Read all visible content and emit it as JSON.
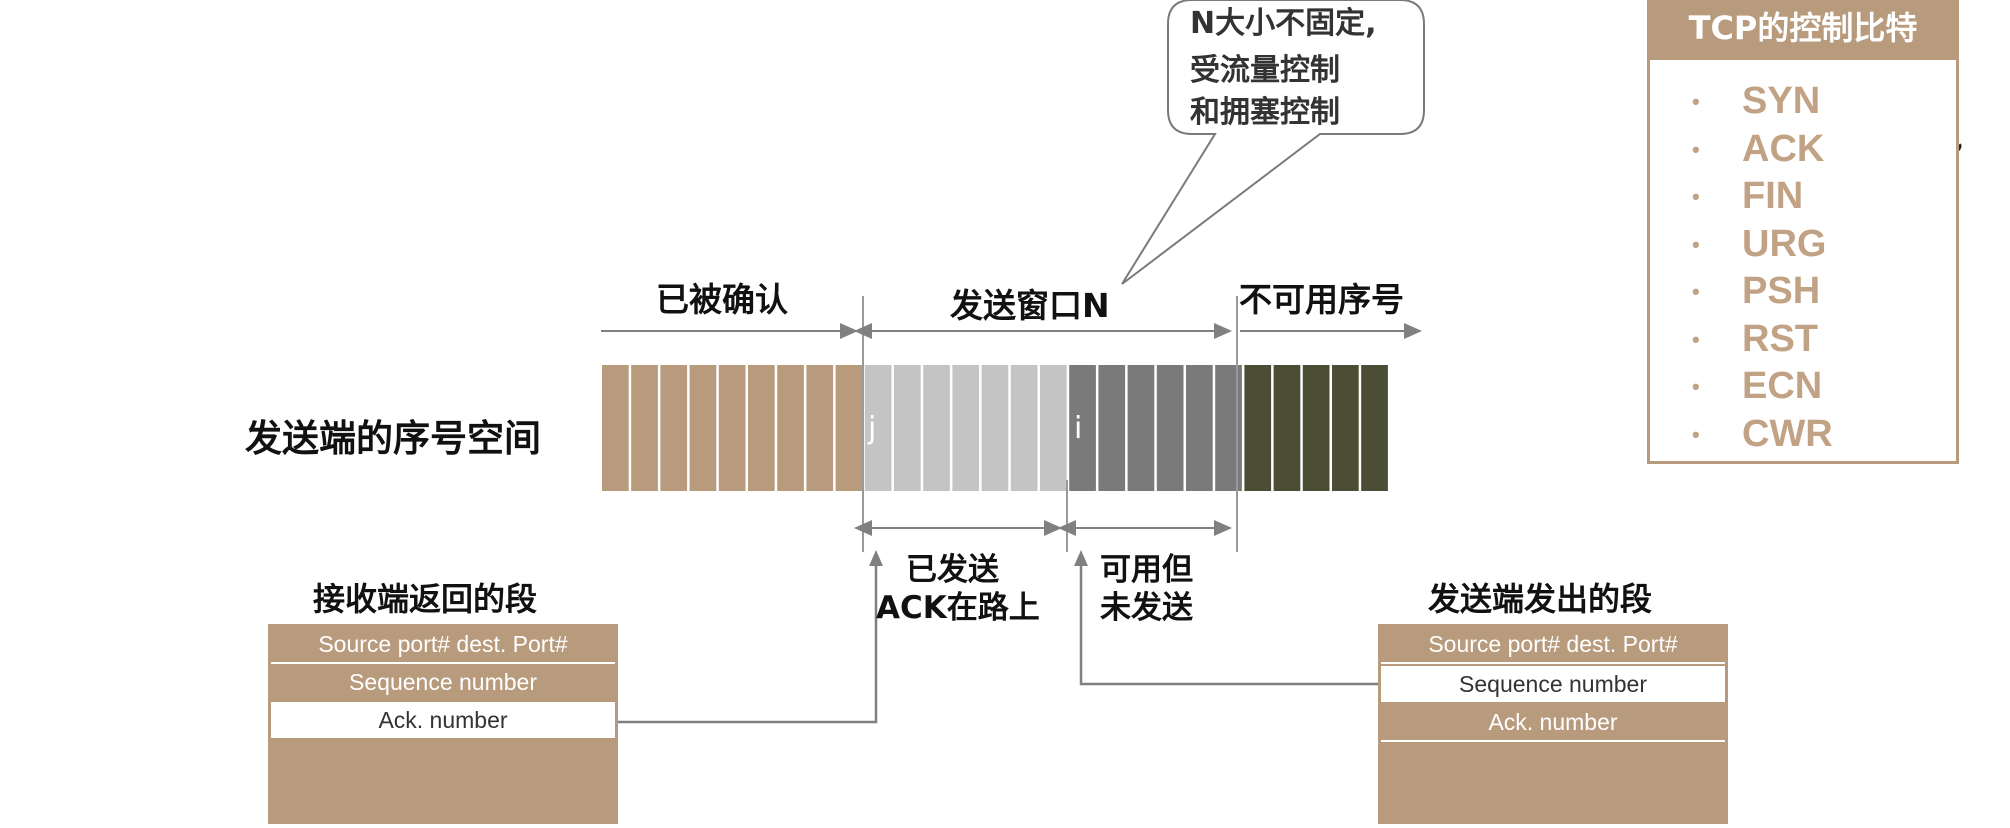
{
  "top_labels": {
    "confirmed": "已被确认",
    "window": "发送窗口N",
    "unusable": "不可用序号"
  },
  "row_label": "发送端的序号空间",
  "slot_markers": {
    "j": "j",
    "i": "i"
  },
  "bottom_labels": {
    "sent_ack_line1": "已发送",
    "sent_ack_line2": "ACK在路上",
    "usable_line1": "可用但",
    "usable_line2": "未发送"
  },
  "callout": {
    "line1": "N大小不固定,",
    "line2": "受流量控制",
    "line3": "和拥塞控制"
  },
  "receiver_segment": {
    "title": "接收端返回的段",
    "rows": [
      "Source port#  dest. Port#",
      "Sequence number",
      "Ack. number"
    ],
    "highlighted_row": "Ack. number"
  },
  "sender_segment": {
    "title": "发送端发出的段",
    "rows": [
      "Source port#  dest. Port#",
      "Sequence number",
      "Ack. number"
    ],
    "highlighted_row": "Sequence number"
  },
  "flags_panel": {
    "title": "TCP的控制比特",
    "items": [
      "SYN",
      "ACK",
      "FIN",
      "URG",
      "PSH",
      "RST",
      "ECN",
      "CWR"
    ],
    "circled": "ACK"
  },
  "colors": {
    "acked": "#b89a7d",
    "sent_unacked": "#c4c4c4",
    "usable": "#7a7a7a",
    "unusable": "#4b4d35",
    "segment": "#b89a7d",
    "flag_text": "#c2a285"
  },
  "sequence_counts": {
    "acked": 9,
    "sent_unacked": 7,
    "usable_unsent": 6,
    "unusable": 5
  }
}
